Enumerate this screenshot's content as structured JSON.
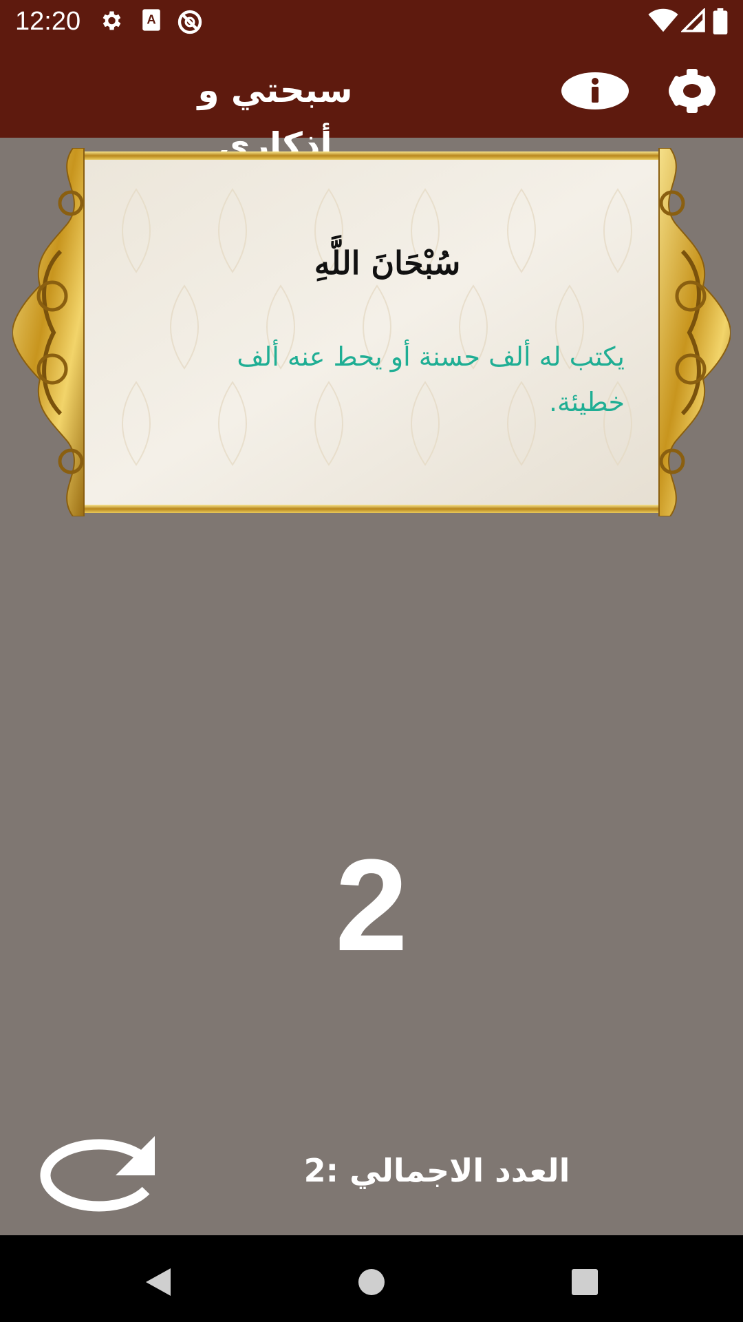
{
  "status_bar": {
    "time": "12:20",
    "icons": [
      "settings-icon",
      "keyboard-a-icon",
      "do-not-disturb-icon",
      "wifi-icon",
      "signal-icon",
      "battery-icon"
    ]
  },
  "app_bar": {
    "title": "سبحتي و أذكاري",
    "info_icon": "info-icon",
    "settings_icon": "gear-icon",
    "color": "#5e1a0e"
  },
  "dhikr": {
    "text": "سُبْحَانَ اللَّهِ",
    "virtue": "يكتب له ألف حسنة أو يحط عنه ألف خطيئة.",
    "virtue_color": "#1fae94"
  },
  "counter": {
    "value": "2"
  },
  "footer": {
    "total_label": "العدد الاجمالي :2",
    "reset_icon": "refresh-icon"
  },
  "nav": {
    "icons": [
      "back-icon",
      "home-icon",
      "recents-icon"
    ]
  },
  "colors": {
    "background": "#7f7772",
    "frame_gold": "#d4a72c"
  }
}
